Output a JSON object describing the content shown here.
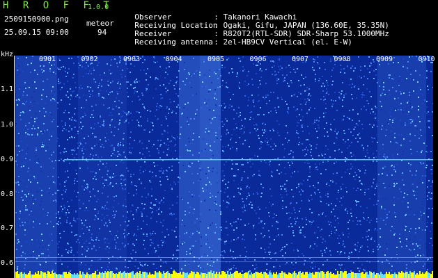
{
  "header": {
    "app_title": "H R O F F T",
    "version": "1.0.0",
    "filename": "2509150900.png",
    "datetime": "25.09.15 09:00",
    "meteor_label": "meteor",
    "meteor_count": "94"
  },
  "info": [
    {
      "label": "Observer",
      "value": ": Takanori Kawachi"
    },
    {
      "label": "Receiving Location",
      "value": ": Ogaki, Gifu, JAPAN (136.60E, 35.35N)"
    },
    {
      "label": "Receiver",
      "value": ": R820T2(RTL-SDR) SDR-Sharp 53.1000MHz"
    },
    {
      "label": "Receiving antenna",
      "value": ": 2el-HB9CV Vertical (el. E-W)"
    }
  ],
  "axis": {
    "unit": "kHz",
    "y_ticks": [
      "1.1",
      "1.0",
      "0.9",
      "0.8",
      "0.7",
      "0.6"
    ],
    "x_ticks": [
      "0901",
      "0902",
      "0903",
      "0904",
      "0905",
      "0906",
      "0907",
      "0908",
      "0909",
      "0910"
    ]
  },
  "colors": {
    "header_green": "#7fe84a",
    "header_white": "#ffffff",
    "background_noise": "#0a2a9a",
    "signal_line": "#6fe0ff",
    "bottom_band": "#ffff00"
  }
}
